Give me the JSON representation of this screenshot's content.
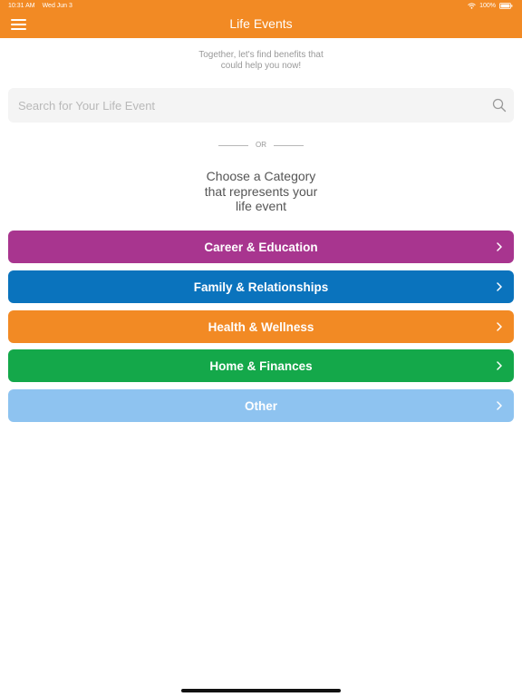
{
  "status_bar": {
    "time": "10:31 AM",
    "date": "Wed Jun 3",
    "battery": "100%",
    "icons": [
      "wifi-icon",
      "battery-icon"
    ]
  },
  "header": {
    "title": "Life Events",
    "menu_icon": "hamburger-menu-icon",
    "background_color": "#f28a24"
  },
  "intro": {
    "tagline_line1": "Together, let's find benefits that",
    "tagline_line2": "could help you now!"
  },
  "search": {
    "placeholder": "Search for Your Life Event",
    "value": "",
    "icon": "search-icon"
  },
  "divider": {
    "text": "OR"
  },
  "choose": {
    "line1": "Choose a Category",
    "line2": "that represents your",
    "line3": "life event"
  },
  "categories": [
    {
      "label": "Career & Education",
      "color": "#a8358f"
    },
    {
      "label": "Family & Relationships",
      "color": "#0a73bd"
    },
    {
      "label": "Health & Wellness",
      "color": "#f28a24"
    },
    {
      "label": "Home & Finances",
      "color": "#14a84a"
    },
    {
      "label": "Other",
      "color": "#8ec3f0"
    }
  ]
}
